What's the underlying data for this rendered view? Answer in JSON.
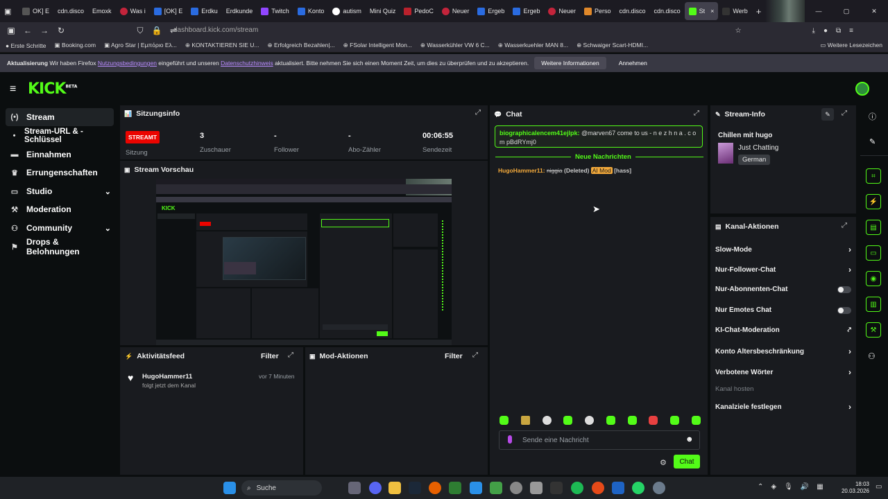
{
  "browser": {
    "tabs": [
      "OK] E",
      "cdn.disco",
      "Emoxk",
      "Was i",
      "[OK] E",
      "Erdku",
      "Erdkunde",
      "Twitch",
      "Konto",
      "autism",
      "Mini Quiz",
      "PedoC",
      "Neuer",
      "Ergeb",
      "Ergeb",
      "Neuer",
      "Perso",
      "cdn.disco",
      "cdn.disco",
      "St",
      "Werb"
    ],
    "url": "dashboard.kick.com/stream",
    "bookmarks": [
      "Erste Schritte",
      "Booking.com",
      "Agro Star | Εμπόριο Ελ...",
      "KONTAKTIEREN SIE U...",
      "Erfolgreich Bezahlen|...",
      "FSolar Intelligent Mon...",
      "Wasserkühler VW 6 C...",
      "Wasserkuehler MAN 8...",
      "Schwaiger Scart-HDMI..."
    ],
    "bookmarks_more": "Weitere Lesezeichen",
    "notice": {
      "bold": "Aktualisierung",
      "t1": " Wir haben Firefox ",
      "l1": "Nutzungsbedingungen",
      "t2": " eingeführt und unseren ",
      "l2": "Datenschutzhinweis",
      "t3": " aktualisiert. Bitte nehmen Sie sich einen Moment Zeit, um dies zu überprüfen und zu akzeptieren.",
      "more": "Weitere Informationen",
      "accept": "Annehmen"
    }
  },
  "kick": {
    "logo": "KICK",
    "beta": "BETA"
  },
  "sidebar": [
    {
      "label": "Stream",
      "icon": "(•)"
    },
    {
      "label": "Stream-URL & -Schlüssel",
      "icon": "•"
    },
    {
      "label": "Einnahmen",
      "icon": "▬"
    },
    {
      "label": "Errungenschaften",
      "icon": "🏆"
    },
    {
      "label": "Studio",
      "icon": "▭"
    },
    {
      "label": "Moderation",
      "icon": "🔧"
    },
    {
      "label": "Community",
      "icon": "👥"
    },
    {
      "label": "Drops & Belohnungen",
      "icon": "⇅"
    }
  ],
  "session": {
    "title": "Sitzungsinfo",
    "live": "STREAMT",
    "live_lbl": "Sitzung",
    "stats": [
      {
        "v": "3",
        "l": "Zuschauer"
      },
      {
        "v": "-",
        "l": "Follower"
      },
      {
        "v": "-",
        "l": "Abo-Zähler"
      },
      {
        "v": "00:06:55",
        "l": "Sendezeit"
      }
    ]
  },
  "preview": {
    "title": "Stream Vorschau"
  },
  "activity": {
    "title": "Aktivitätsfeed",
    "filter": "Filter",
    "user": "HugoHammer11",
    "time": "vor 7 Minuten",
    "text": "folgt jetzt dem Kanal"
  },
  "mod": {
    "title": "Mod-Aktionen",
    "filter": "Filter"
  },
  "chat": {
    "title": "Chat",
    "pinned_user": "biographicalencem41ejlpk:",
    "pinned_msg": " @marven67 come to us - n e z h n a . c o m pBdRYmj0",
    "new_msgs": "Neue Nachrichten",
    "msg_user": "HugoHammer11:",
    "msg_word": "niggia",
    "msg_deleted": "(Deleted)",
    "msg_badge": "AI Mod",
    "msg_reason": "[hass]",
    "placeholder": "Sende eine Nachricht",
    "send": "Chat"
  },
  "stream_info": {
    "title": "Stream-Info",
    "stream_title": "Chillen mit hugo",
    "category": "Just Chatting",
    "language": "German"
  },
  "channel_actions": {
    "title": "Kanal-Aktionen",
    "items": [
      "Slow-Mode",
      "Nur-Follower-Chat",
      "Nur-Abonnenten-Chat",
      "Nur Emotes Chat",
      "KI-Chat-Moderation",
      "Konto Altersbeschränkung",
      "Verbotene Wörter",
      "Kanal hosten",
      "Kanalziele festlegen"
    ]
  },
  "taskbar": {
    "search": "Suche",
    "time": "18:03",
    "date": "20.03.2026"
  },
  "colors": {
    "brand": "#53fc18",
    "live": "#eb0400",
    "aimod": "#f2a93b"
  }
}
